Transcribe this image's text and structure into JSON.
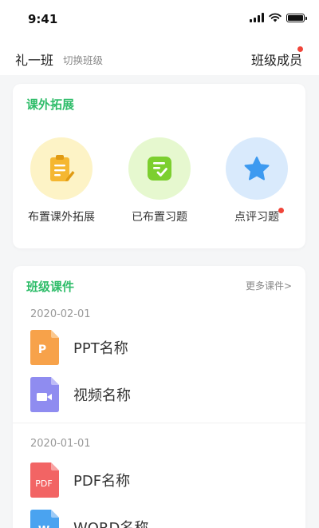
{
  "status_bar": {
    "time": "9:41",
    "battery_level": 1.0
  },
  "header": {
    "class_name": "礼一班",
    "switch_label": "切换班级",
    "members_label": "班级成员",
    "members_badge": true
  },
  "extension": {
    "title": "课外拓展",
    "items": [
      {
        "label": "布置课外拓展",
        "icon": "clipboard-edit-icon",
        "circle_color": "#fdf3c6",
        "icon_color": "#f5b731",
        "badge": false
      },
      {
        "label": "已布置习题",
        "icon": "checklist-icon",
        "circle_color": "#e6f8cf",
        "icon_color": "#7ccf2f",
        "badge": false
      },
      {
        "label": "点评习题",
        "icon": "star-icon",
        "circle_color": "#d9eafc",
        "icon_color": "#3d9af0",
        "badge": true
      }
    ]
  },
  "courseware": {
    "title": "班级课件",
    "more_label": "更多课件>",
    "groups": [
      {
        "date": "2020-02-01",
        "files": [
          {
            "name": "PPT名称",
            "type": "ppt",
            "icon_label": "P",
            "color": "#f7a24a"
          },
          {
            "name": "视频名称",
            "type": "video",
            "icon_label": "",
            "color": "#8f8cf0"
          }
        ]
      },
      {
        "date": "2020-01-01",
        "files": [
          {
            "name": "PDF名称",
            "type": "pdf",
            "icon_label": "PDF",
            "color": "#f26464"
          },
          {
            "name": "WORD名称",
            "type": "word",
            "icon_label": "W",
            "color": "#4aa3f0"
          }
        ]
      }
    ]
  },
  "colors": {
    "accent": "#2fbd6a",
    "badge": "#f0453a"
  }
}
